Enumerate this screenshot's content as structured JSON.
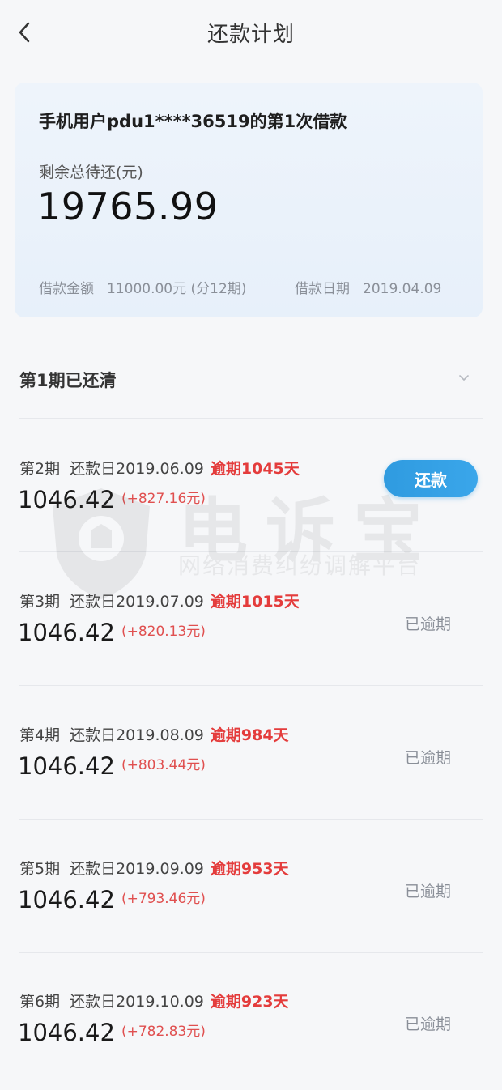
{
  "header": {
    "title": "还款计划"
  },
  "summary": {
    "title": "手机用户pdu1****36519的第1次借款",
    "remaining_label": "剩余总待还(元)",
    "remaining_amount": "19765.99",
    "loan_amount_label": "借款金额",
    "loan_amount_value": "11000.00元 (分12期)",
    "loan_date_label": "借款日期",
    "loan_date_value": "2019.04.09"
  },
  "paid_section": {
    "label": "第1期已还清"
  },
  "watermark": {
    "title": "电诉宝",
    "subtitle": "网络消费纠纷调解平台"
  },
  "periods": [
    {
      "period": "第2期",
      "due_date": "还款日2019.06.09",
      "overdue": "逾期1045天",
      "amount": "1046.42",
      "interest": "(+827.16元)",
      "action": "还款"
    },
    {
      "period": "第3期",
      "due_date": "还款日2019.07.09",
      "overdue": "逾期1015天",
      "amount": "1046.42",
      "interest": "(+820.13元)",
      "status": "已逾期"
    },
    {
      "period": "第4期",
      "due_date": "还款日2019.08.09",
      "overdue": "逾期984天",
      "amount": "1046.42",
      "interest": "(+803.44元)",
      "status": "已逾期"
    },
    {
      "period": "第5期",
      "due_date": "还款日2019.09.09",
      "overdue": "逾期953天",
      "amount": "1046.42",
      "interest": "(+793.46元)",
      "status": "已逾期"
    },
    {
      "period": "第6期",
      "due_date": "还款日2019.10.09",
      "overdue": "逾期923天",
      "amount": "1046.42",
      "interest": "(+782.83元)",
      "status": "已逾期"
    }
  ],
  "colors": {
    "accent_blue": "#2f9be0",
    "overdue_red": "#e43c3c",
    "card_bg": "#eef4fb"
  }
}
